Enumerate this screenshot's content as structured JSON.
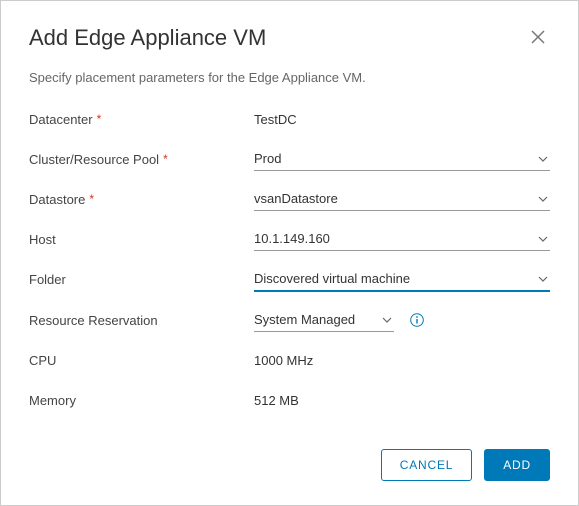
{
  "dialog": {
    "title": "Add Edge Appliance VM",
    "subtitle": "Specify placement parameters for the Edge Appliance VM."
  },
  "labels": {
    "datacenter": "Datacenter",
    "cluster": "Cluster/Resource Pool",
    "datastore": "Datastore",
    "host": "Host",
    "folder": "Folder",
    "reservation": "Resource Reservation",
    "cpu": "CPU",
    "memory": "Memory"
  },
  "values": {
    "datacenter": "TestDC",
    "cluster": "Prod",
    "datastore": "vsanDatastore",
    "host": "10.1.149.160",
    "folder": "Discovered virtual machine",
    "reservation": "System Managed",
    "cpu": "1000 MHz",
    "memory": "512 MB"
  },
  "required_marker": "*",
  "buttons": {
    "cancel": "Cancel",
    "add": "Add"
  }
}
